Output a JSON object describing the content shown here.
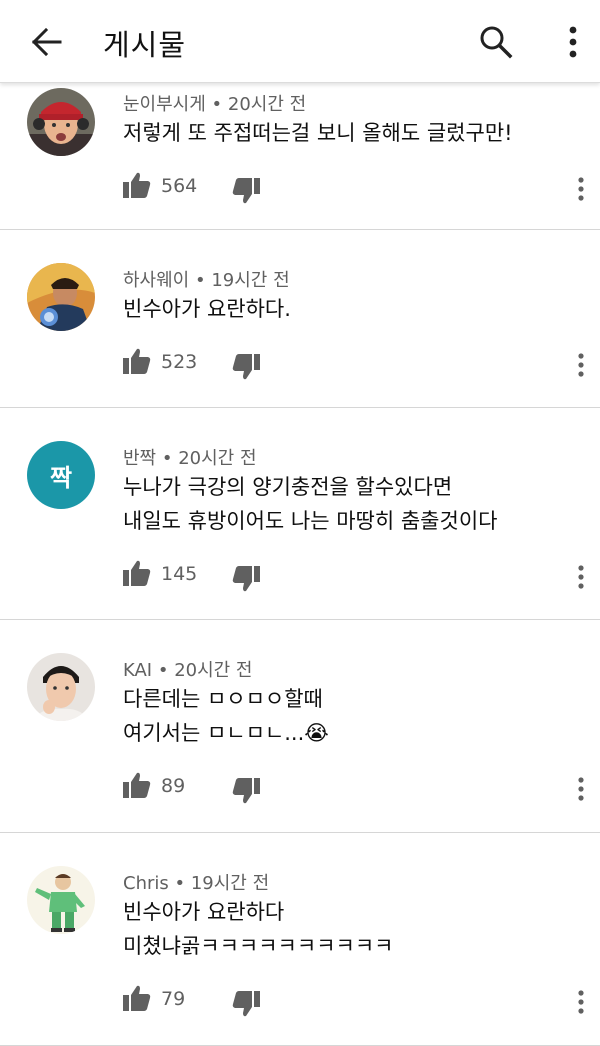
{
  "header": {
    "title": "게시물"
  },
  "comments": [
    {
      "author": "눈이부시게",
      "time": "20시간 전",
      "lines": [
        "저렇게 또 주접떠는걸 보니 올해도 글렀구만!"
      ],
      "likes": "564"
    },
    {
      "author": "하사웨이",
      "time": "19시간 전",
      "lines": [
        "빈수아가 요란하다."
      ],
      "likes": "523"
    },
    {
      "author": "반짝",
      "time": "20시간 전",
      "lines": [
        "누나가 극강의 양기충전을 할수있다면",
        "내일도 휴방이어도 나는 마땅히 춤출것이다"
      ],
      "likes": "145",
      "avatar_letter": "짝",
      "avatar_color": "#1b97a8"
    },
    {
      "author": "KAI",
      "time": "20시간 전",
      "lines": [
        "다른데는 ㅁㅇㅁㅇ할때",
        "여기서는 ㅁㄴㅁㄴ...😭"
      ],
      "likes": "89"
    },
    {
      "author": "Chris",
      "time": "19시간 전",
      "lines": [
        "빈수아가 요란하다",
        "미쳤냐곩ㅋㅋㅋㅋㅋㅋㅋㅋㅋㅋ"
      ],
      "likes": "79"
    }
  ],
  "icons": {
    "back": "arrow-left-icon",
    "search": "search-icon",
    "more": "more-vert-icon",
    "like": "thumb-up-icon",
    "dislike": "thumb-down-icon"
  },
  "colors": {
    "meta_text": "#606060",
    "divider": "#d6d6d6"
  }
}
